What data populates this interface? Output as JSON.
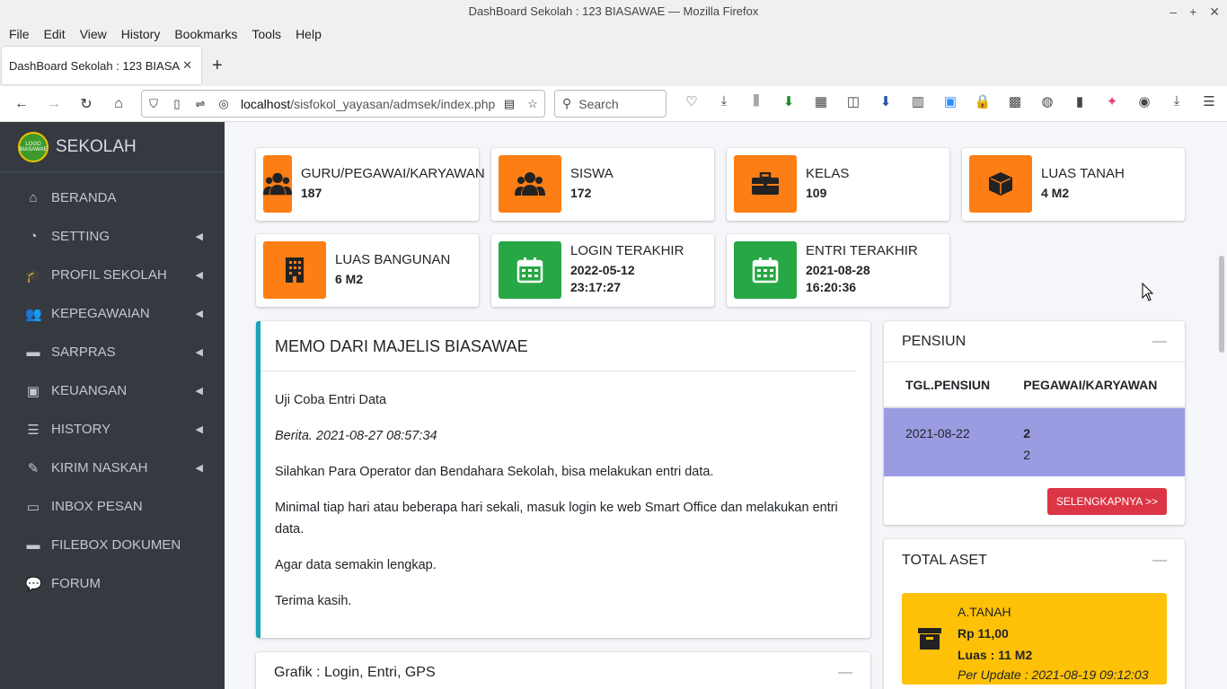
{
  "browser": {
    "window_title": "DashBoard Sekolah : 123 BIASAWAE — Mozilla Firefox",
    "menu": [
      "File",
      "Edit",
      "View",
      "History",
      "Bookmarks",
      "Tools",
      "Help"
    ],
    "tab_title": "DashBoard Sekolah : 123 BIASAWAE",
    "url_host": "localhost",
    "url_path": "/sisfokol_yayasan/admsek/index.php",
    "search_placeholder": "Search"
  },
  "sidebar": {
    "brand": "SEKOLAH",
    "logo_text": "LOGO BIASAWAE",
    "items": [
      {
        "label": "BERANDA",
        "icon": "home-icon",
        "arrow": false
      },
      {
        "label": "SETTING",
        "icon": "tachometer-icon",
        "arrow": true
      },
      {
        "label": "PROFIL SEKOLAH",
        "icon": "graduation-cap-icon",
        "arrow": true
      },
      {
        "label": "KEPEGAWAIAN",
        "icon": "users-icon",
        "arrow": true
      },
      {
        "label": "SARPRAS",
        "icon": "archive-icon",
        "arrow": true
      },
      {
        "label": "KEUANGAN",
        "icon": "money-icon",
        "arrow": true
      },
      {
        "label": "HISTORY",
        "icon": "server-icon",
        "arrow": true
      },
      {
        "label": "KIRIM NASKAH",
        "icon": "pencil-icon",
        "arrow": true
      },
      {
        "label": "INBOX PESAN",
        "icon": "inbox-icon",
        "arrow": false
      },
      {
        "label": "FILEBOX DOKUMEN",
        "icon": "archive-icon",
        "arrow": false
      },
      {
        "label": "FORUM",
        "icon": "comments-icon",
        "arrow": false
      }
    ]
  },
  "infoboxes": [
    {
      "label": "GURU/PEGAWAI/KARYAWAN",
      "value": "187",
      "color": "#fd7e14",
      "icon": "users-icon"
    },
    {
      "label": "SISWA",
      "value": "172",
      "color": "#fd7e14",
      "icon": "users-icon"
    },
    {
      "label": "KELAS",
      "value": "109",
      "color": "#fd7e14",
      "icon": "briefcase-icon"
    },
    {
      "label": "LUAS TANAH",
      "value": "4 M2",
      "color": "#fd7e14",
      "icon": "cube-icon"
    },
    {
      "label": "LUAS BANGUNAN",
      "value": "6 M2",
      "color": "#fd7e14",
      "icon": "building-icon"
    },
    {
      "label": "LOGIN TERAKHIR",
      "value": "2022-05-12",
      "value2": "23:17:27",
      "color": "#28a745",
      "icon": "calendar-icon"
    },
    {
      "label": "ENTRI TERAKHIR",
      "value": "2021-08-28",
      "value2": "16:20:36",
      "color": "#28a745",
      "icon": "calendar-icon"
    }
  ],
  "memo": {
    "title": "MEMO DARI MAJELIS BIASAWAE",
    "subject": "Uji Coba Entri Data",
    "meta": "Berita. 2021-08-27 08:57:34",
    "p1": "Silahkan Para Operator dan Bendahara Sekolah, bisa melakukan entri data.",
    "p2": "Minimal tiap hari atau beberapa hari sekali, masuk login ke web Smart Office dan melakukan entri data.",
    "p3": "Agar data semakin lengkap.",
    "p4": "Terima kasih."
  },
  "grafik": {
    "title": "Grafik : Login, Entri, GPS"
  },
  "pensiun": {
    "title": "PENSIUN",
    "col1": "TGL.PENSIUN",
    "col2": "PEGAWAI/KARYAWAN",
    "row_date": "2021-08-22",
    "row_bold": "2",
    "row_normal": "2",
    "button": "SELENGKAPNYA >>"
  },
  "aset": {
    "title": "TOTAL ASET",
    "name": "A.TANAH",
    "amount": "Rp 11,00",
    "area": "Luas : 11 M2",
    "update": "Per Update : 2021-08-19 09:12:03"
  }
}
